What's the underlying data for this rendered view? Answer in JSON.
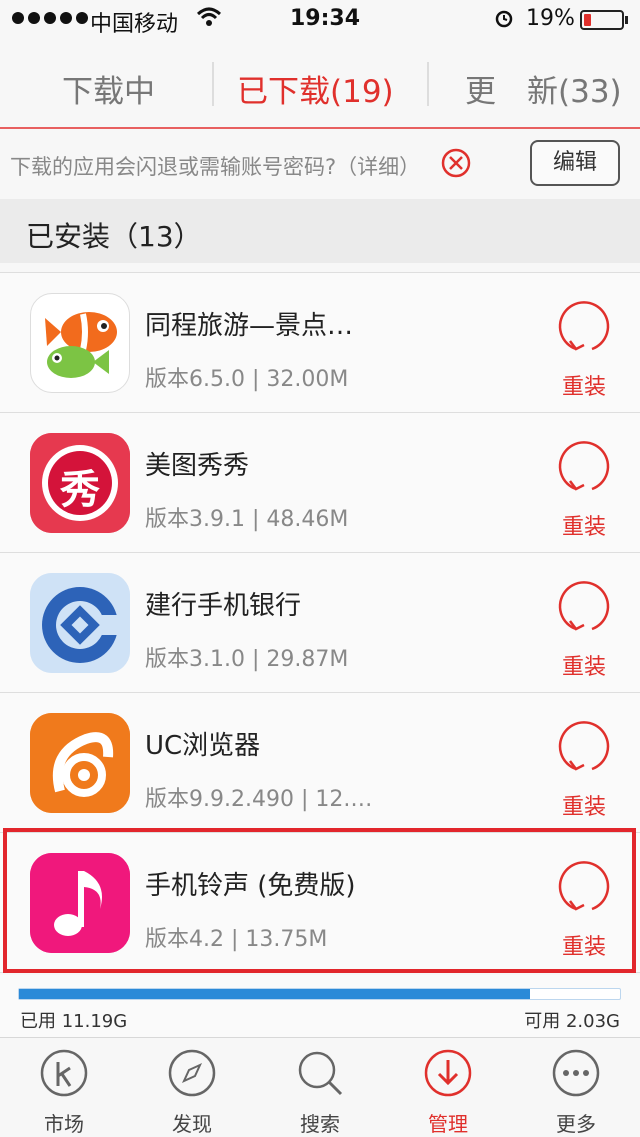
{
  "status_bar": {
    "carrier": "中国移动",
    "time": "19:34",
    "battery": "19%",
    "battery_level": 0.19
  },
  "tabs": [
    {
      "label": "下载中"
    },
    {
      "label": "已下载(19)"
    },
    {
      "label": "更　新(33)"
    }
  ],
  "notice": {
    "text": "下载的应用会闪退或需输账号密码?（详细）",
    "edit_label": "编辑"
  },
  "section": {
    "title": "已安装（13）"
  },
  "apps": [
    {
      "name": "同程旅游—景点…",
      "meta": "版本6.5.0 | 32.00M",
      "action": "重装",
      "icon": "fish-icon"
    },
    {
      "name": "美图秀秀",
      "meta": "版本3.9.1 | 48.46M",
      "action": "重装",
      "icon": "meitu-icon",
      "icon_text": "秀"
    },
    {
      "name": "建行手机银行",
      "meta": "版本3.1.0 | 29.87M",
      "action": "重装",
      "icon": "ccb-icon"
    },
    {
      "name": "UC浏览器",
      "meta": "版本9.9.2.490 | 12.…",
      "action": "重装",
      "icon": "squirrel-icon"
    },
    {
      "name": "手机铃声 (免费版)",
      "meta": "版本4.2 | 13.75M",
      "action": "重装",
      "icon": "music-note-icon"
    }
  ],
  "storage": {
    "used": "已用 11.19G",
    "free": "可用 2.03G",
    "used_fraction": 0.85
  },
  "nav": [
    {
      "label": "市场",
      "icon": "market-icon"
    },
    {
      "label": "发现",
      "icon": "compass-icon"
    },
    {
      "label": "搜索",
      "icon": "search-icon"
    },
    {
      "label": "管理",
      "icon": "download-icon"
    },
    {
      "label": "更多",
      "icon": "more-icon"
    }
  ],
  "colors": {
    "accent": "#e0302c",
    "storage": "#2b8ad8"
  }
}
